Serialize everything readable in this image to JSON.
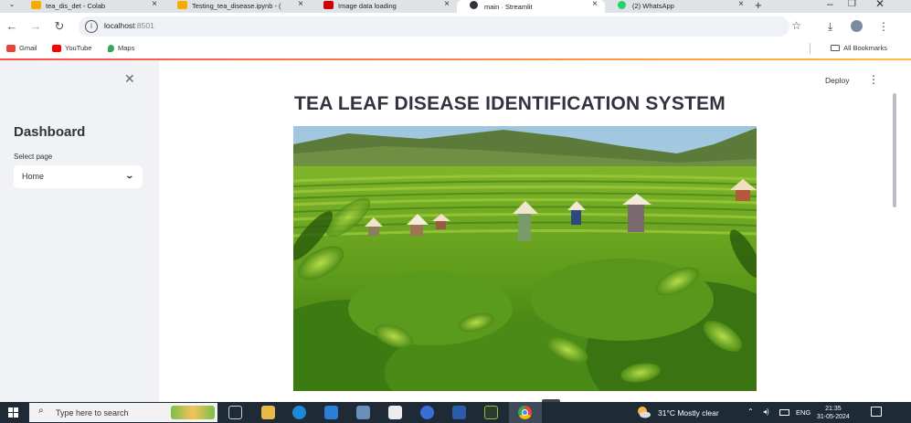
{
  "browser": {
    "tabs": [
      {
        "title": "tea_dis_det - Colab",
        "icon": "colab-icon",
        "color": "#f9ab00",
        "active": false
      },
      {
        "title": "Testing_tea_disease.ipynb - (",
        "icon": "colab-icon",
        "color": "#f9ab00",
        "active": false
      },
      {
        "title": "Image data loading",
        "icon": "keras-icon",
        "color": "#d00000",
        "active": false
      },
      {
        "title": "main · Streamlit",
        "icon": "streamlit-icon",
        "color": "#31333f",
        "active": true
      },
      {
        "title": "(2) WhatsApp",
        "icon": "whatsapp-icon",
        "color": "#25d366",
        "active": false
      }
    ],
    "url_host": "localhost",
    "url_port": ":8501",
    "bookmarks": [
      {
        "label": "Gmail",
        "icon": "gmail-icon",
        "color": "#ea4335"
      },
      {
        "label": "YouTube",
        "icon": "youtube-icon",
        "color": "#ff0000"
      },
      {
        "label": "Maps",
        "icon": "maps-icon",
        "color": "#34a853"
      }
    ],
    "all_bookmarks": "All Bookmarks"
  },
  "sidebar": {
    "title": "Dashboard",
    "select_label": "Select page",
    "select_value": "Home"
  },
  "main": {
    "deploy_label": "Deploy",
    "title": "TEA LEAF DISEASE IDENTIFICATION SYSTEM"
  },
  "taskbar": {
    "search_placeholder": "Type here to search",
    "weather": "31°C  Mostly clear",
    "lang": "ENG",
    "time": "21:35",
    "date": "31-05-2024"
  },
  "colors": {
    "streamlit_accent": "#ff4b4b",
    "sidebar_bg": "#f0f2f6",
    "text": "#31333f",
    "taskbar_bg": "#1f2a37"
  }
}
